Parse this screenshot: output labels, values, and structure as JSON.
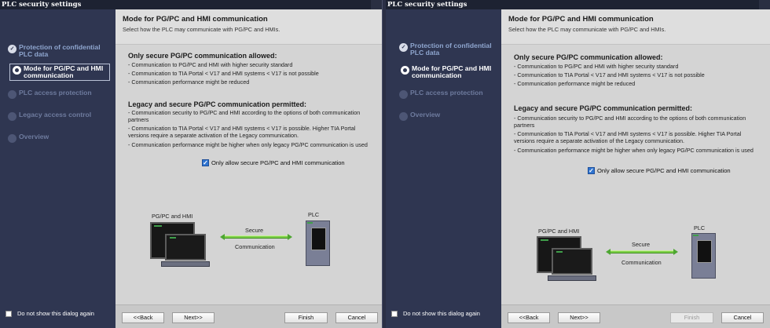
{
  "windows": [
    {
      "title": "PLC security settings",
      "nav": [
        {
          "label": "Protection of confidential PLC data",
          "state": "done"
        },
        {
          "label": "Mode for PG/PC and HMI communication",
          "state": "active"
        },
        {
          "label": "PLC access protection",
          "state": "pending"
        },
        {
          "label": "Legacy access control",
          "state": "pending"
        },
        {
          "label": "Overview",
          "state": "pending"
        }
      ],
      "dont_show": "Do not show this dialog again",
      "header_title": "Mode for PG/PC and HMI communication",
      "header_subtitle": "Select how the PLC may communicate with PG/PC and HMIs.",
      "secure_title": "Only secure PG/PC communication allowed:",
      "secure_lines": [
        "- Communication to PG/PC and HMI with higher security standard",
        "- Communication to TIA Portal < V17 and HMI systems < V17 is not possible",
        "- Communication performance might be reduced"
      ],
      "legacy_title": "Legacy and secure PG/PC communication permitted:",
      "legacy_lines": [
        "- Communication security to PG/PC and HMI according to the options of both communication partners",
        "- Communication to TIA Portal < V17 and HMI systems < V17 is possible. Higher TIA Portal versions require a separate activation of the Legacy communication.",
        "- Communication performance might be higher when only legacy PG/PC communication is used"
      ],
      "checkbox_label": "Only allow secure PG/PC and HMI communication",
      "checkbox_checked": true,
      "diagram": {
        "pgpc": "PG/PC and HMI",
        "plc": "PLC",
        "arrow_top": "Secure",
        "arrow_bottom": "Communication"
      },
      "buttons": {
        "back": "<<Back",
        "next": "Next>>",
        "finish": "Finish",
        "cancel": "Cancel"
      }
    },
    {
      "title": "PLC security settings",
      "nav": [
        {
          "label": "Protection of confidential PLC data",
          "state": "done"
        },
        {
          "label": "Mode for PG/PC and HMI communication",
          "state": "active"
        },
        {
          "label": "PLC access protection",
          "state": "pending"
        },
        {
          "label": "Overview",
          "state": "pending"
        }
      ],
      "dont_show": "Do not show this dialog again",
      "header_title": "Mode for PG/PC and HMI communication",
      "header_subtitle": "Select how the PLC may communicate with PG/PC and HMIs.",
      "secure_title": "Only secure PG/PC communication allowed:",
      "secure_lines": [
        "- Communication to PG/PC and HMI with higher security standard",
        "- Communication to TIA Portal < V17 and HMI systems < V17 is not possible",
        "- Communication performance might be reduced"
      ],
      "legacy_title": "Legacy and secure PG/PC communication permitted:",
      "legacy_lines": [
        "- Communication security to PG/PC and HMI according to the options of both communication partners",
        "- Communication to TIA Portal < V17 and HMI systems < V17 is possible. Higher TIA Portal versions require a separate activation of the Legacy communication.",
        "- Communication performance might be higher when only legacy PG/PC communication is used"
      ],
      "checkbox_label": "Only allow secure PG/PC and HMI communication",
      "checkbox_checked": true,
      "diagram": {
        "pgpc": "PG/PC and HMI",
        "plc": "PLC",
        "arrow_top": "Secure",
        "arrow_bottom": "Communication"
      },
      "buttons": {
        "back": "<<Back",
        "next": "Next>>",
        "finish": "Finish",
        "cancel": "Cancel"
      }
    }
  ],
  "colors": {
    "sidebar": "#2f3651",
    "accent_check": "#2f74d0",
    "arrow": "#7fd24a"
  }
}
